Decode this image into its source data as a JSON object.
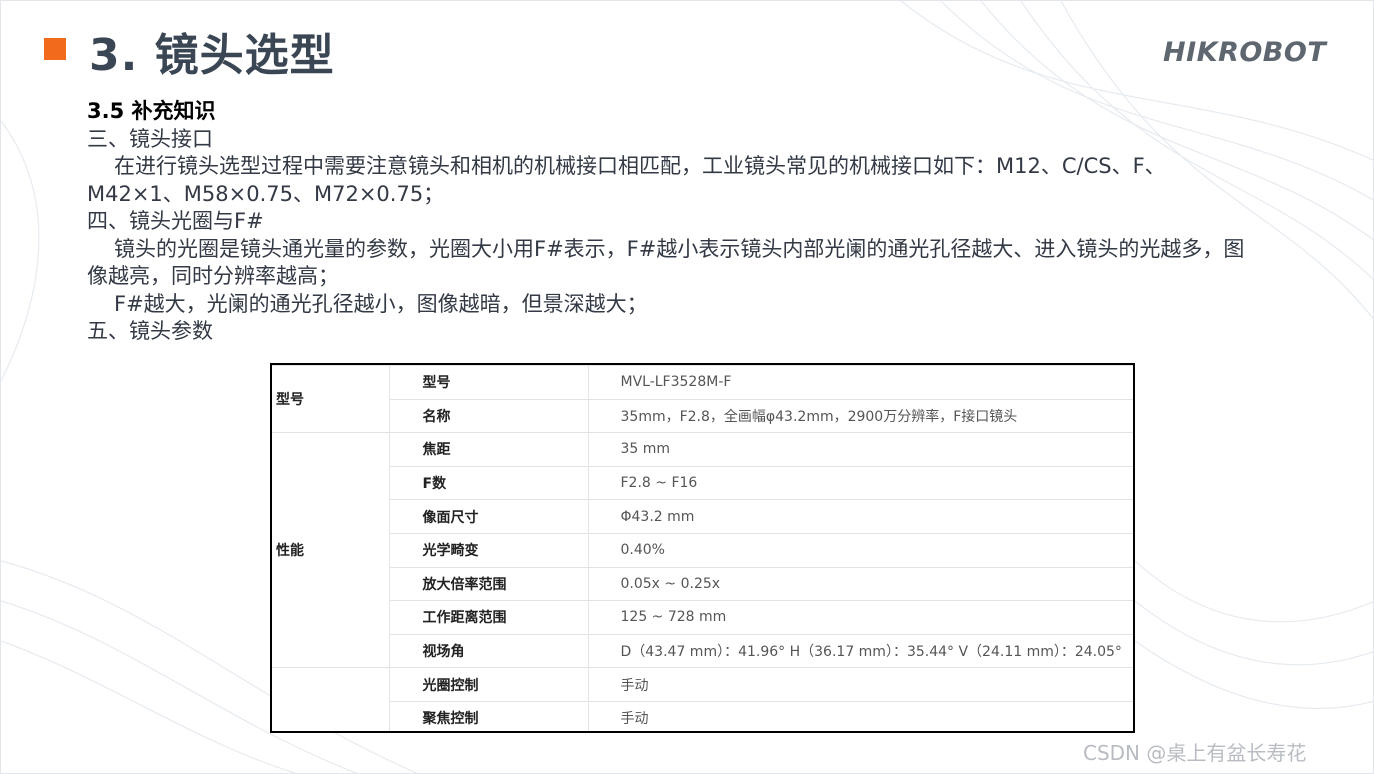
{
  "slide": {
    "title": "3. 镜头选型",
    "logo": "HIKROBOT",
    "accent_color": "#f26a1b",
    "watermark": "CSDN @桌上有盆长寿花"
  },
  "content": {
    "section_heading": "3.5 补充知识",
    "item3_heading": "三、镜头接口",
    "item3_text": "在进行镜头选型过程中需要注意镜头和相机的机械接口相匹配，工业镜头常见的机械接口如下：M12、C/CS、F、M42×1、M58×0.75、M72×0.75；",
    "item4_heading": "四、镜头光圈与F#",
    "item4_text1": "镜头的光圈是镜头通光量的参数，光圈大小用F#表示，F#越小表示镜头内部光阑的通光孔径越大、进入镜头的光越多，图像越亮，同时分辨率越高；",
    "item4_text2": "F#越大，光阑的通光孔径越小，图像越暗，但景深越大；",
    "item5_heading": "五、镜头参数"
  },
  "spec_table": {
    "groups": [
      "型号",
      "性能"
    ],
    "rows": [
      {
        "label": "型号",
        "value": "MVL-LF3528M-F"
      },
      {
        "label": "名称",
        "value": "35mm，F2.8，全画幅φ43.2mm，2900万分辨率，F接口镜头"
      },
      {
        "label": "焦距",
        "value": "35 mm"
      },
      {
        "label": "F数",
        "value": "F2.8 ~ F16"
      },
      {
        "label": "像面尺寸",
        "value": "Φ43.2 mm"
      },
      {
        "label": "光学畸变",
        "value": "0.40%"
      },
      {
        "label": "放大倍率范围",
        "value": "0.05x ~ 0.25x"
      },
      {
        "label": "工作距离范围",
        "value": "125 ~ 728 mm"
      },
      {
        "label": "视场角",
        "value": "D（43.47 mm）：41.96° H（36.17 mm）：35.44° V（24.11 mm）：24.05°"
      },
      {
        "label": "光圈控制",
        "value": "手动"
      },
      {
        "label": "聚焦控制",
        "value": "手动"
      }
    ]
  }
}
